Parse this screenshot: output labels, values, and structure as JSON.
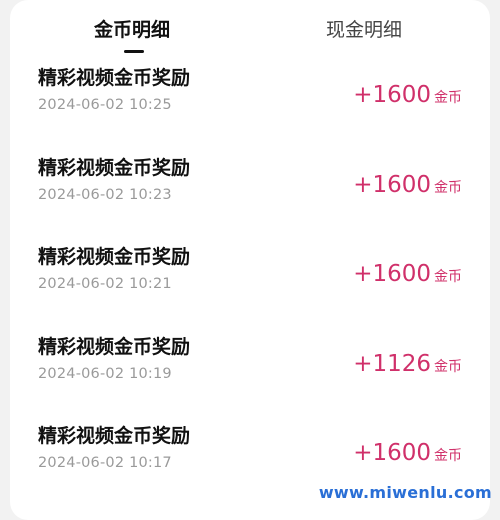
{
  "tabs": [
    {
      "label": "金币明细",
      "active": true
    },
    {
      "label": "现金明细",
      "active": false
    }
  ],
  "records": [
    {
      "title": "精彩视频金币奖励",
      "time": "2024-06-02 10:25",
      "amount": "+1600",
      "unit": "金币"
    },
    {
      "title": "精彩视频金币奖励",
      "time": "2024-06-02 10:23",
      "amount": "+1600",
      "unit": "金币"
    },
    {
      "title": "精彩视频金币奖励",
      "time": "2024-06-02 10:21",
      "amount": "+1600",
      "unit": "金币"
    },
    {
      "title": "精彩视频金币奖励",
      "time": "2024-06-02 10:19",
      "amount": "+1126",
      "unit": "金币"
    },
    {
      "title": "精彩视频金币奖励",
      "time": "2024-06-02 10:17",
      "amount": "+1600",
      "unit": "金币"
    }
  ],
  "watermark": "www.miwenlu.com",
  "colors": {
    "amount": "#d0306a",
    "time": "#9a9a9a",
    "title": "#111111",
    "watermark": "#2a6fd6"
  }
}
